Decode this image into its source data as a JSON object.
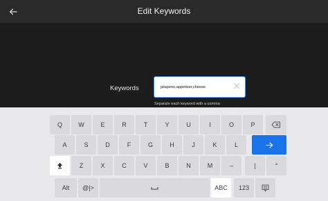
{
  "header": {
    "title": "Edit Keywords",
    "back_icon": "arrow-left-icon"
  },
  "form": {
    "label": "Keywords",
    "value": "jalapeno,appetizer,cheese",
    "helper": "Separate each keyword with a comma",
    "clear_icon": "close-icon"
  },
  "keyboard": {
    "row1": [
      "Q",
      "W",
      "E",
      "R",
      "T",
      "Y",
      "U",
      "I",
      "O",
      "P"
    ],
    "row2": [
      "A",
      "S",
      "D",
      "F",
      "G",
      "H",
      "J",
      "K",
      "L"
    ],
    "row3": [
      "Z",
      "X",
      "C",
      "V",
      "B",
      "N",
      "M",
      "–",
      "|",
      "°"
    ],
    "bottom": {
      "alt": "Alt",
      "sym": "@|>",
      "abc": "ABC",
      "num": "123"
    },
    "icons": {
      "backspace": "backspace-icon",
      "enter": "arrow-right-icon",
      "shift": "shift-icon",
      "space": "space-icon",
      "emoji": "emoji-keyboard-icon"
    },
    "accent_color": "#1a73e8"
  }
}
